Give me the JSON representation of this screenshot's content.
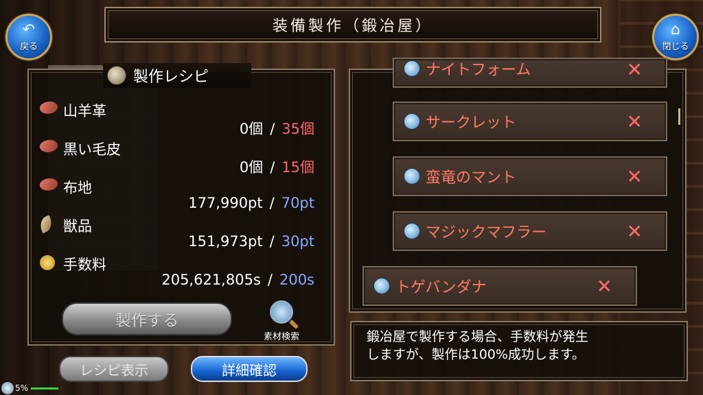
{
  "header": {
    "title": "装備製作（鍛冶屋）",
    "back_label": "戻る",
    "close_label": "閉じる"
  },
  "recipe": {
    "heading": "製作レシピ",
    "materials": [
      {
        "name": "山羊革",
        "have": "0個",
        "need": "35個",
        "need_color": "red",
        "icon": "pelt-icon"
      },
      {
        "name": "黒い毛皮",
        "have": "0個",
        "need": "15個",
        "need_color": "red",
        "icon": "pelt-icon"
      },
      {
        "name": "布地",
        "have": "177,990pt",
        "need": "70pt",
        "need_color": "blue",
        "icon": "pelt-icon"
      },
      {
        "name": "獣品",
        "have": "151,973pt",
        "need": "30pt",
        "need_color": "blue",
        "icon": "fang-icon"
      },
      {
        "name": "手数料",
        "have": "205,621,805s",
        "need": "200s",
        "need_color": "blue",
        "icon": "coin-icon"
      }
    ],
    "separator": "/",
    "craft_label": "製作する",
    "search_label": "素材検索"
  },
  "tabs": {
    "recipe_label": "レシピ表示",
    "detail_label": "詳細確認"
  },
  "item_list": [
    {
      "name": "ナイトフォーム",
      "mark": "✕"
    },
    {
      "name": "サークレット",
      "mark": "✕"
    },
    {
      "name": "蛮竜のマント",
      "mark": "✕"
    },
    {
      "name": "マジックマフラー",
      "mark": "✕"
    },
    {
      "name": "トゲバンダナ",
      "mark": "✕"
    }
  ],
  "info": {
    "line1": "鍛冶屋で製作する場合、手数料が発生",
    "line2": "しますが、製作は100%成功します。"
  },
  "status": {
    "percent": "5%"
  },
  "colors": {
    "need_red": "#ff6a6a",
    "need_blue": "#8aa8ff",
    "item_text": "#ff7a6a",
    "accent_blue": "#1563d0"
  }
}
